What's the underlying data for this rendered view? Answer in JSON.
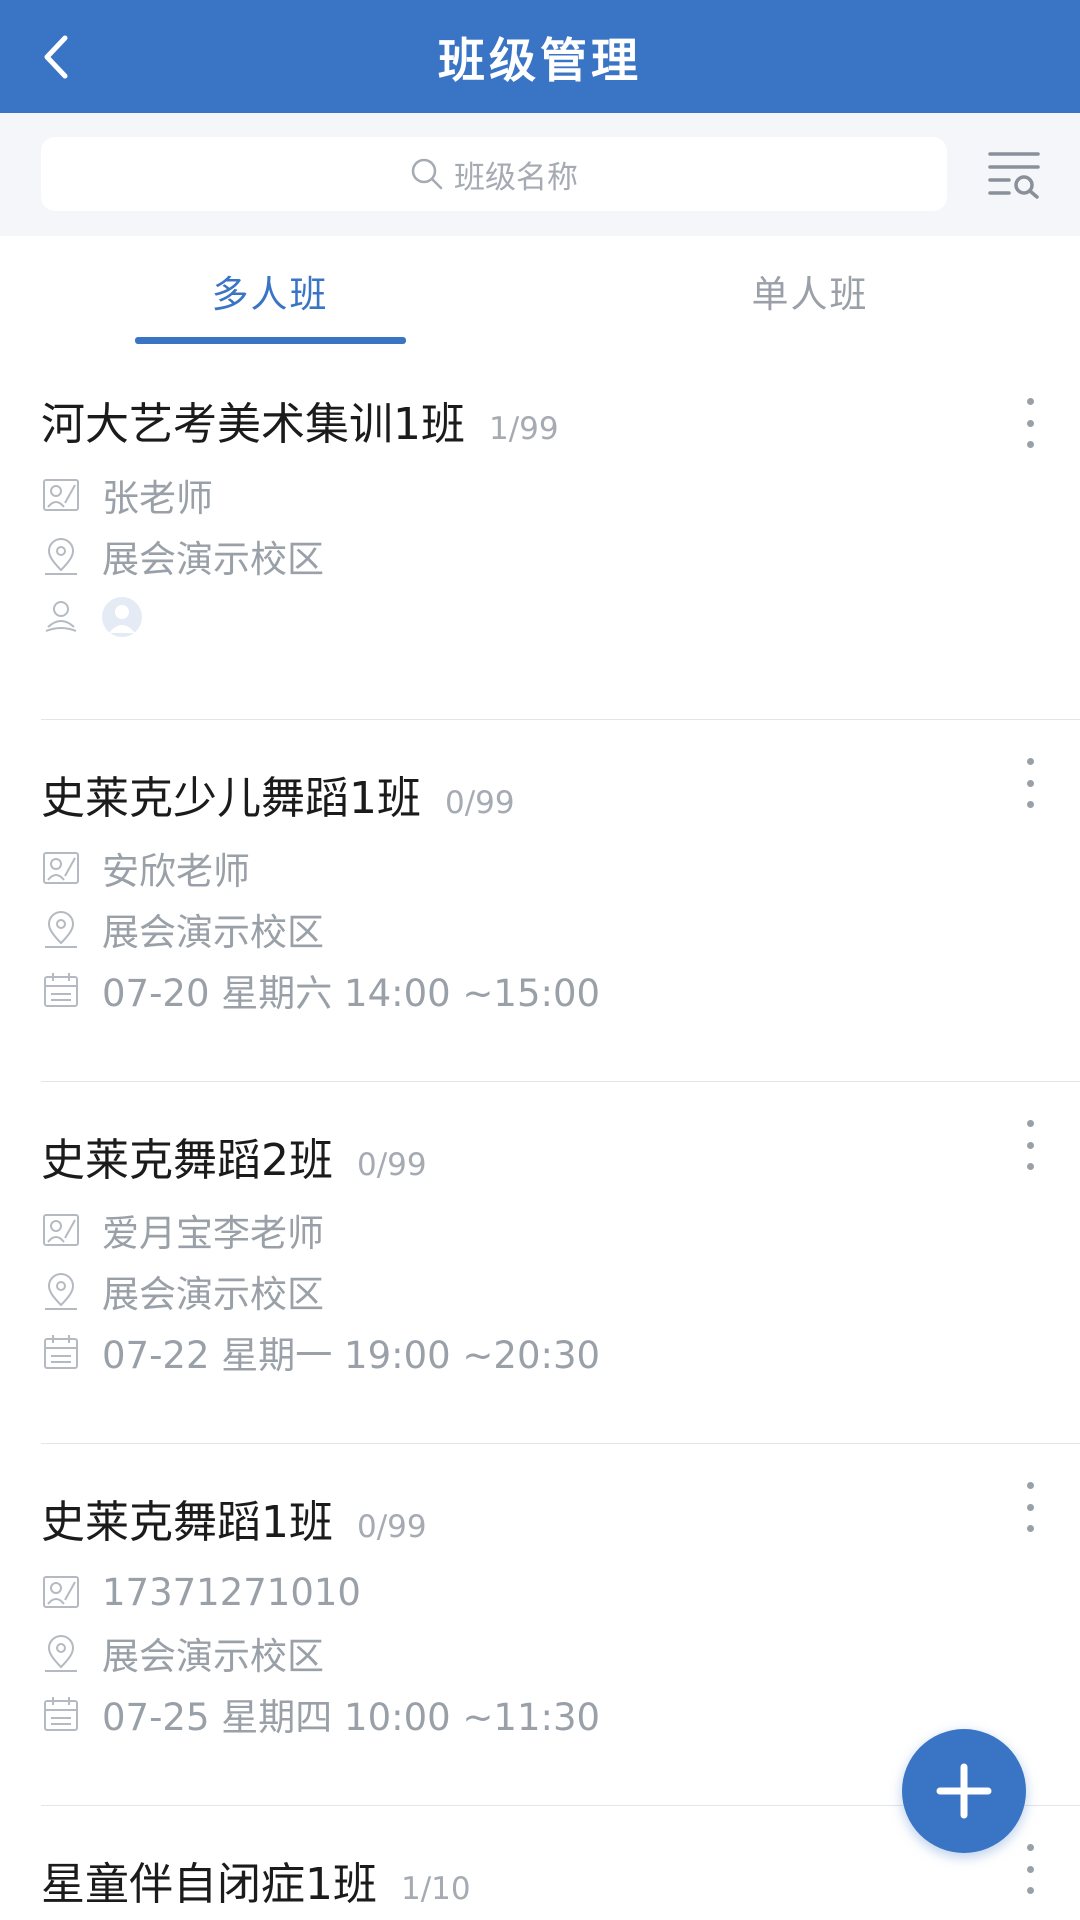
{
  "header": {
    "title": "班级管理"
  },
  "search": {
    "placeholder": "班级名称"
  },
  "tabs": [
    {
      "label": "多人班",
      "active": true
    },
    {
      "label": "单人班",
      "active": false
    }
  ],
  "classes": [
    {
      "name": "河大艺考美术集训1班",
      "count": "1/99",
      "teacher": "张老师",
      "campus": "展会演示校区",
      "has_student_avatar": true
    },
    {
      "name": "史莱克少儿舞蹈1班",
      "count": "0/99",
      "teacher": "安欣老师",
      "campus": "展会演示校区",
      "schedule": "07-20  星期六  14:00 ~15:00"
    },
    {
      "name": "史莱克舞蹈2班",
      "count": "0/99",
      "teacher": "爱月宝李老师",
      "campus": "展会演示校区",
      "schedule": "07-22  星期一  19:00 ~20:30"
    },
    {
      "name": "史莱克舞蹈1班",
      "count": "0/99",
      "teacher": "17371271010",
      "campus": "展会演示校区",
      "schedule": "07-25  星期四  10:00 ~11:30"
    },
    {
      "name": "星童伴自闭症1班",
      "count": "1/10"
    }
  ],
  "colors": {
    "primary": "#3a74c4",
    "muted": "#9aa0a8"
  }
}
